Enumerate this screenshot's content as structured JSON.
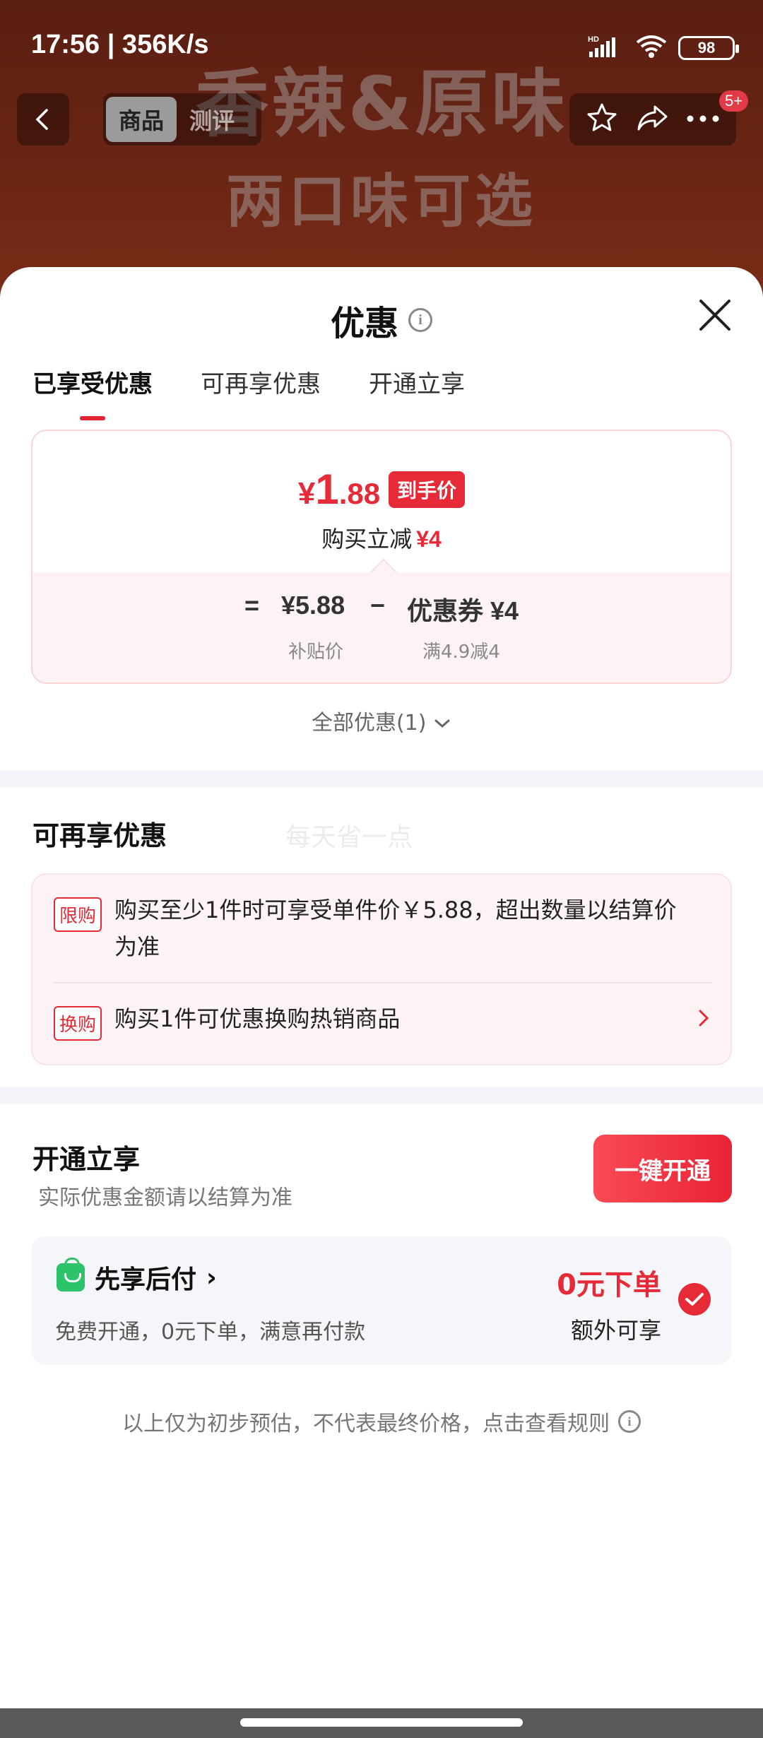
{
  "status_bar": {
    "time_speed": "17:56 | 356K/s",
    "network_label": "HD",
    "battery": "98"
  },
  "background": {
    "line1": "香辣&原味",
    "line2": "两口味可选"
  },
  "top_nav": {
    "segments": [
      "商品",
      "测评"
    ],
    "badge": "5+"
  },
  "sheet": {
    "title": "优惠",
    "tabs": [
      "已享受优惠",
      "可再享优惠",
      "开通立享"
    ]
  },
  "price_card": {
    "currency": "¥",
    "price_int": "1",
    "price_dec": ".88",
    "price_tag": "到手价",
    "instant_label": "购买立减",
    "instant_value": "¥4",
    "equals": "=",
    "subsidy_price": "¥5.88",
    "minus": "−",
    "coupon": "优惠券 ¥4",
    "subsidy_label": "补贴价",
    "coupon_condition": "满4.9减4"
  },
  "all_discounts": "全部优惠(1)",
  "more_offers": {
    "title": "可再享优惠",
    "watermark": "每天省一点",
    "items": [
      {
        "tag": "限购",
        "text": "购买至少1件时可享受单件价￥5.88，超出数量以结算价为准"
      },
      {
        "tag": "换购",
        "text": "购买1件可优惠换购热销商品"
      }
    ]
  },
  "open_section": {
    "title": "开通立享",
    "subtitle": "实际优惠金额请以结算为准",
    "button": "一键开通",
    "pay_title": "先享后付",
    "pay_arrow": "›",
    "pay_desc": "免费开通，0元下单，满意再付款",
    "pay_zero": "0元下单",
    "pay_extra": "额外可享"
  },
  "disclaimer": "以上仅为初步预估，不代表最终价格，点击查看规则",
  "colors": {
    "accent_red": "#e62a37",
    "green": "#2cc36b"
  }
}
